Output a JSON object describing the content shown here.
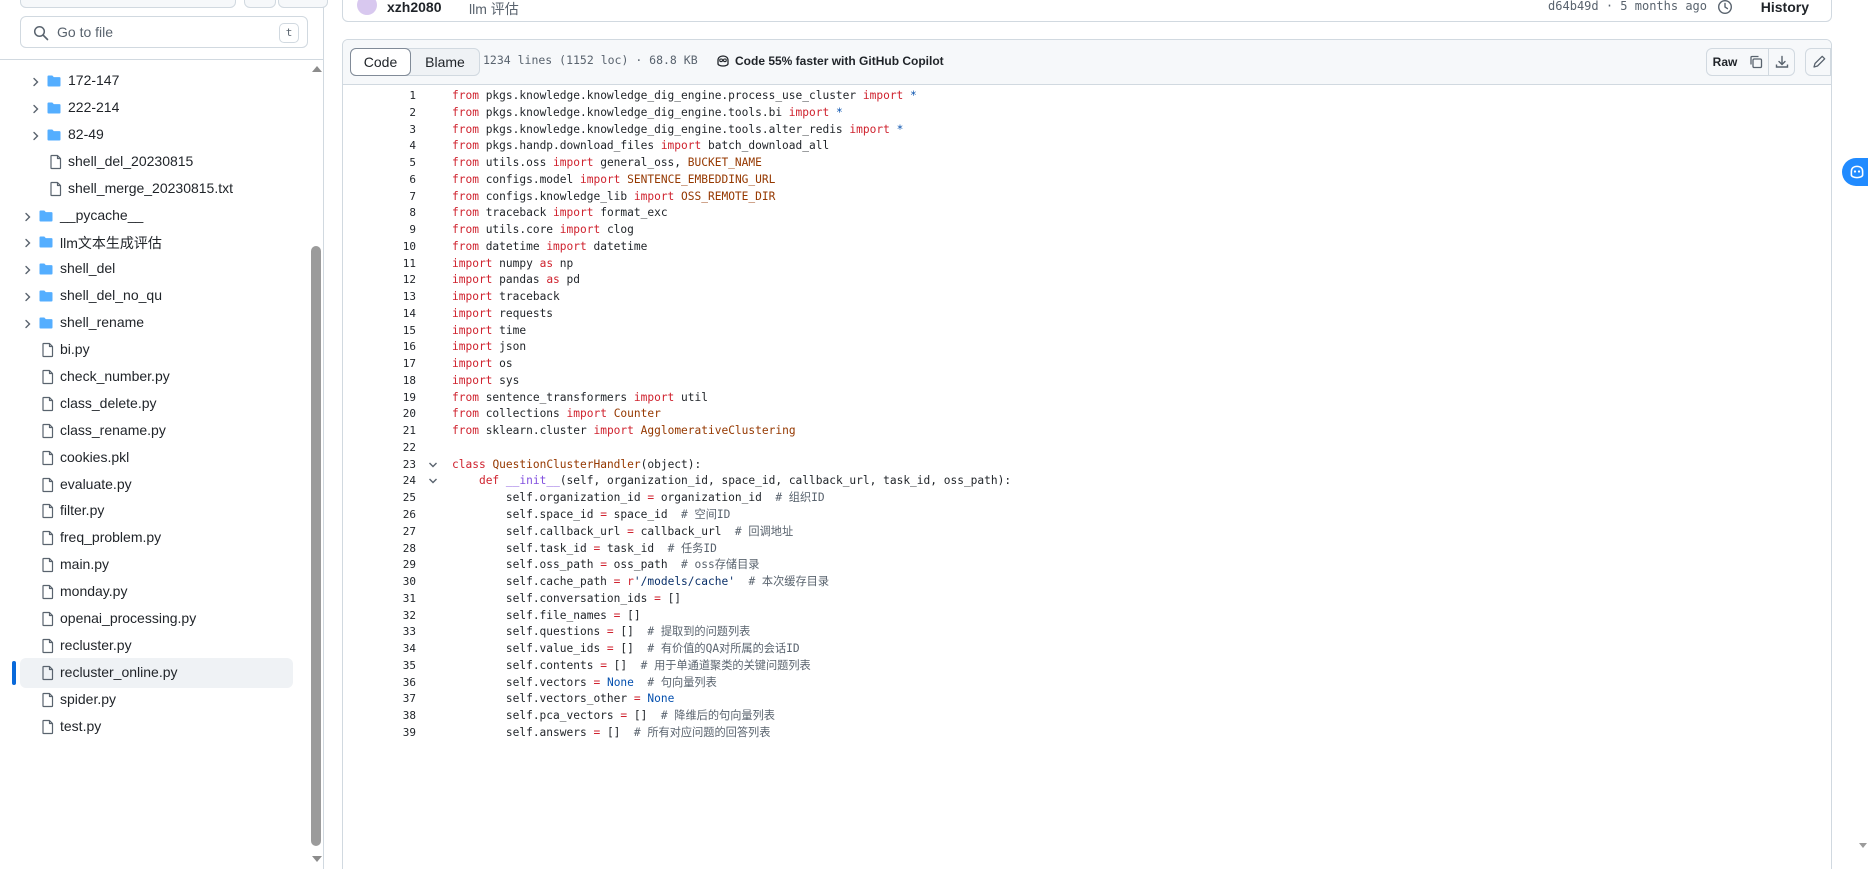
{
  "sidebar": {
    "goto_placeholder": "Go to file",
    "goto_shortcut": "t",
    "items": [
      {
        "type": "folder",
        "label": "172-147",
        "depth": 1
      },
      {
        "type": "folder",
        "label": "222-214",
        "depth": 1
      },
      {
        "type": "folder",
        "label": "82-49",
        "depth": 1
      },
      {
        "type": "file",
        "label": "shell_del_20230815",
        "depth": 1
      },
      {
        "type": "file",
        "label": "shell_merge_20230815.txt",
        "depth": 1
      },
      {
        "type": "folder",
        "label": "__pycache__",
        "depth": 0
      },
      {
        "type": "folder",
        "label": "llm文本生成评估",
        "depth": 0
      },
      {
        "type": "folder",
        "label": "shell_del",
        "depth": 0
      },
      {
        "type": "folder",
        "label": "shell_del_no_qu",
        "depth": 0
      },
      {
        "type": "folder",
        "label": "shell_rename",
        "depth": 0
      },
      {
        "type": "file",
        "label": "bi.py",
        "depth": 0
      },
      {
        "type": "file",
        "label": "check_number.py",
        "depth": 0
      },
      {
        "type": "file",
        "label": "class_delete.py",
        "depth": 0
      },
      {
        "type": "file",
        "label": "class_rename.py",
        "depth": 0
      },
      {
        "type": "file",
        "label": "cookies.pkl",
        "depth": 0
      },
      {
        "type": "file",
        "label": "evaluate.py",
        "depth": 0
      },
      {
        "type": "file",
        "label": "filter.py",
        "depth": 0
      },
      {
        "type": "file",
        "label": "freq_problem.py",
        "depth": 0
      },
      {
        "type": "file",
        "label": "main.py",
        "depth": 0
      },
      {
        "type": "file",
        "label": "monday.py",
        "depth": 0
      },
      {
        "type": "file",
        "label": "openai_processing.py",
        "depth": 0
      },
      {
        "type": "file",
        "label": "recluster.py",
        "depth": 0
      },
      {
        "type": "file",
        "label": "recluster_online.py",
        "depth": 0,
        "selected": true
      },
      {
        "type": "file",
        "label": "spider.py",
        "depth": 0
      },
      {
        "type": "file",
        "label": "test.py",
        "depth": 0
      }
    ]
  },
  "commit": {
    "author": "xzh2080",
    "message": "llm 评估",
    "meta": "d64b49d · 5 months ago",
    "history_label": "History"
  },
  "file": {
    "tab_code": "Code",
    "tab_blame": "Blame",
    "info": "1234 lines (1152 loc) · 68.8 KB",
    "copilot_text": "Code 55% faster with GitHub Copilot",
    "raw_label": "Raw"
  },
  "colors": {
    "accent": "#0969da",
    "keyword": "#cf222e",
    "constant": "#0550ae",
    "entity": "#953800",
    "function": "#8250df",
    "string": "#0a3069",
    "comment": "#59636e"
  },
  "code_lines": [
    {
      "n": "1",
      "tokens": [
        [
          "k",
          "from"
        ],
        [
          "t",
          " pkgs.knowledge.knowledge_dig_engine.process_use_cluster "
        ],
        [
          "k",
          "import"
        ],
        [
          "t",
          " "
        ],
        [
          "c",
          "*"
        ]
      ]
    },
    {
      "n": "2",
      "tokens": [
        [
          "k",
          "from"
        ],
        [
          "t",
          " pkgs.knowledge.knowledge_dig_engine.tools.bi "
        ],
        [
          "k",
          "import"
        ],
        [
          "t",
          " "
        ],
        [
          "c",
          "*"
        ]
      ]
    },
    {
      "n": "3",
      "tokens": [
        [
          "k",
          "from"
        ],
        [
          "t",
          " pkgs.knowledge.knowledge_dig_engine.tools.alter_redis "
        ],
        [
          "k",
          "import"
        ],
        [
          "t",
          " "
        ],
        [
          "c",
          "*"
        ]
      ]
    },
    {
      "n": "4",
      "tokens": [
        [
          "k",
          "from"
        ],
        [
          "t",
          " pkgs.handp.download_files "
        ],
        [
          "k",
          "import"
        ],
        [
          "t",
          " batch_download_all"
        ]
      ]
    },
    {
      "n": "5",
      "tokens": [
        [
          "k",
          "from"
        ],
        [
          "t",
          " utils.oss "
        ],
        [
          "k",
          "import"
        ],
        [
          "t",
          " general_oss, "
        ],
        [
          "e",
          "BUCKET_NAME"
        ]
      ]
    },
    {
      "n": "6",
      "tokens": [
        [
          "k",
          "from"
        ],
        [
          "t",
          " configs.model "
        ],
        [
          "k",
          "import"
        ],
        [
          "t",
          " "
        ],
        [
          "e",
          "SENTENCE_EMBEDDING_URL"
        ]
      ]
    },
    {
      "n": "7",
      "tokens": [
        [
          "k",
          "from"
        ],
        [
          "t",
          " configs.knowledge_lib "
        ],
        [
          "k",
          "import"
        ],
        [
          "t",
          " "
        ],
        [
          "e",
          "OSS_REMOTE_DIR"
        ]
      ]
    },
    {
      "n": "8",
      "tokens": [
        [
          "k",
          "from"
        ],
        [
          "t",
          " traceback "
        ],
        [
          "k",
          "import"
        ],
        [
          "t",
          " format_exc"
        ]
      ]
    },
    {
      "n": "9",
      "tokens": [
        [
          "k",
          "from"
        ],
        [
          "t",
          " utils.core "
        ],
        [
          "k",
          "import"
        ],
        [
          "t",
          " clog"
        ]
      ]
    },
    {
      "n": "10",
      "tokens": [
        [
          "k",
          "from"
        ],
        [
          "t",
          " datetime "
        ],
        [
          "k",
          "import"
        ],
        [
          "t",
          " datetime"
        ]
      ]
    },
    {
      "n": "11",
      "tokens": [
        [
          "k",
          "import"
        ],
        [
          "t",
          " numpy "
        ],
        [
          "k",
          "as"
        ],
        [
          "t",
          " np"
        ]
      ]
    },
    {
      "n": "12",
      "tokens": [
        [
          "k",
          "import"
        ],
        [
          "t",
          " pandas "
        ],
        [
          "k",
          "as"
        ],
        [
          "t",
          " pd"
        ]
      ]
    },
    {
      "n": "13",
      "tokens": [
        [
          "k",
          "import"
        ],
        [
          "t",
          " traceback"
        ]
      ]
    },
    {
      "n": "14",
      "tokens": [
        [
          "k",
          "import"
        ],
        [
          "t",
          " requests"
        ]
      ]
    },
    {
      "n": "15",
      "tokens": [
        [
          "k",
          "import"
        ],
        [
          "t",
          " time"
        ]
      ]
    },
    {
      "n": "16",
      "tokens": [
        [
          "k",
          "import"
        ],
        [
          "t",
          " json"
        ]
      ]
    },
    {
      "n": "17",
      "tokens": [
        [
          "k",
          "import"
        ],
        [
          "t",
          " os"
        ]
      ]
    },
    {
      "n": "18",
      "tokens": [
        [
          "k",
          "import"
        ],
        [
          "t",
          " sys"
        ]
      ]
    },
    {
      "n": "19",
      "tokens": [
        [
          "k",
          "from"
        ],
        [
          "t",
          " sentence_transformers "
        ],
        [
          "k",
          "import"
        ],
        [
          "t",
          " util"
        ]
      ]
    },
    {
      "n": "20",
      "tokens": [
        [
          "k",
          "from"
        ],
        [
          "t",
          " collections "
        ],
        [
          "k",
          "import"
        ],
        [
          "t",
          " "
        ],
        [
          "e",
          "Counter"
        ]
      ]
    },
    {
      "n": "21",
      "tokens": [
        [
          "k",
          "from"
        ],
        [
          "t",
          " sklearn.cluster "
        ],
        [
          "k",
          "import"
        ],
        [
          "t",
          " "
        ],
        [
          "e",
          "AgglomerativeClustering"
        ]
      ]
    },
    {
      "n": "22",
      "tokens": []
    },
    {
      "n": "23",
      "fold": true,
      "tokens": [
        [
          "k",
          "class"
        ],
        [
          "t",
          " "
        ],
        [
          "e",
          "QuestionClusterHandler"
        ],
        [
          "t",
          "(object):"
        ]
      ]
    },
    {
      "n": "24",
      "fold": true,
      "tokens": [
        [
          "t",
          "    "
        ],
        [
          "k",
          "def"
        ],
        [
          "t",
          " "
        ],
        [
          "f",
          "__init__"
        ],
        [
          "t",
          "(self, organization_id, space_id, callback_url, task_id, oss_path):"
        ]
      ]
    },
    {
      "n": "25",
      "tokens": [
        [
          "t",
          "        self.organization_id "
        ],
        [
          "k",
          "="
        ],
        [
          "t",
          " organization_id  "
        ],
        [
          "cm",
          "# 组织ID"
        ]
      ]
    },
    {
      "n": "26",
      "tokens": [
        [
          "t",
          "        self.space_id "
        ],
        [
          "k",
          "="
        ],
        [
          "t",
          " space_id  "
        ],
        [
          "cm",
          "# 空间ID"
        ]
      ]
    },
    {
      "n": "27",
      "tokens": [
        [
          "t",
          "        self.callback_url "
        ],
        [
          "k",
          "="
        ],
        [
          "t",
          " callback_url  "
        ],
        [
          "cm",
          "# 回调地址"
        ]
      ]
    },
    {
      "n": "28",
      "tokens": [
        [
          "t",
          "        self.task_id "
        ],
        [
          "k",
          "="
        ],
        [
          "t",
          " task_id  "
        ],
        [
          "cm",
          "# 任务ID"
        ]
      ]
    },
    {
      "n": "29",
      "tokens": [
        [
          "t",
          "        self.oss_path "
        ],
        [
          "k",
          "="
        ],
        [
          "t",
          " oss_path  "
        ],
        [
          "cm",
          "# oss存储目录"
        ]
      ]
    },
    {
      "n": "30",
      "tokens": [
        [
          "t",
          "        self.cache_path "
        ],
        [
          "k",
          "="
        ],
        [
          "t",
          " "
        ],
        [
          "k",
          "r"
        ],
        [
          "s",
          "'/models/cache'"
        ],
        [
          "t",
          "  "
        ],
        [
          "cm",
          "# 本次缓存目录"
        ]
      ]
    },
    {
      "n": "31",
      "tokens": [
        [
          "t",
          "        self.conversation_ids "
        ],
        [
          "k",
          "="
        ],
        [
          "t",
          " []"
        ]
      ]
    },
    {
      "n": "32",
      "tokens": [
        [
          "t",
          "        self.file_names "
        ],
        [
          "k",
          "="
        ],
        [
          "t",
          " []"
        ]
      ]
    },
    {
      "n": "33",
      "tokens": [
        [
          "t",
          "        self.questions "
        ],
        [
          "k",
          "="
        ],
        [
          "t",
          " []  "
        ],
        [
          "cm",
          "# 提取到的问题列表"
        ]
      ]
    },
    {
      "n": "34",
      "tokens": [
        [
          "t",
          "        self.value_ids "
        ],
        [
          "k",
          "="
        ],
        [
          "t",
          " []  "
        ],
        [
          "cm",
          "# 有价值的QA对所属的会话ID"
        ]
      ]
    },
    {
      "n": "35",
      "tokens": [
        [
          "t",
          "        self.contents "
        ],
        [
          "k",
          "="
        ],
        [
          "t",
          " []  "
        ],
        [
          "cm",
          "# 用于单通道聚类的关键问题列表"
        ]
      ]
    },
    {
      "n": "36",
      "tokens": [
        [
          "t",
          "        self.vectors "
        ],
        [
          "k",
          "="
        ],
        [
          "t",
          " "
        ],
        [
          "c",
          "None"
        ],
        [
          "t",
          "  "
        ],
        [
          "cm",
          "# 句向量列表"
        ]
      ]
    },
    {
      "n": "37",
      "tokens": [
        [
          "t",
          "        self.vectors_other "
        ],
        [
          "k",
          "="
        ],
        [
          "t",
          " "
        ],
        [
          "c",
          "None"
        ]
      ]
    },
    {
      "n": "38",
      "tokens": [
        [
          "t",
          "        self.pca_vectors "
        ],
        [
          "k",
          "="
        ],
        [
          "t",
          " []  "
        ],
        [
          "cm",
          "# 降维后的句向量列表"
        ]
      ]
    },
    {
      "n": "39",
      "tokens": [
        [
          "t",
          "        self.answers "
        ],
        [
          "k",
          "="
        ],
        [
          "t",
          " []  "
        ],
        [
          "cm",
          "# 所有对应问题的回答列表"
        ]
      ]
    }
  ]
}
